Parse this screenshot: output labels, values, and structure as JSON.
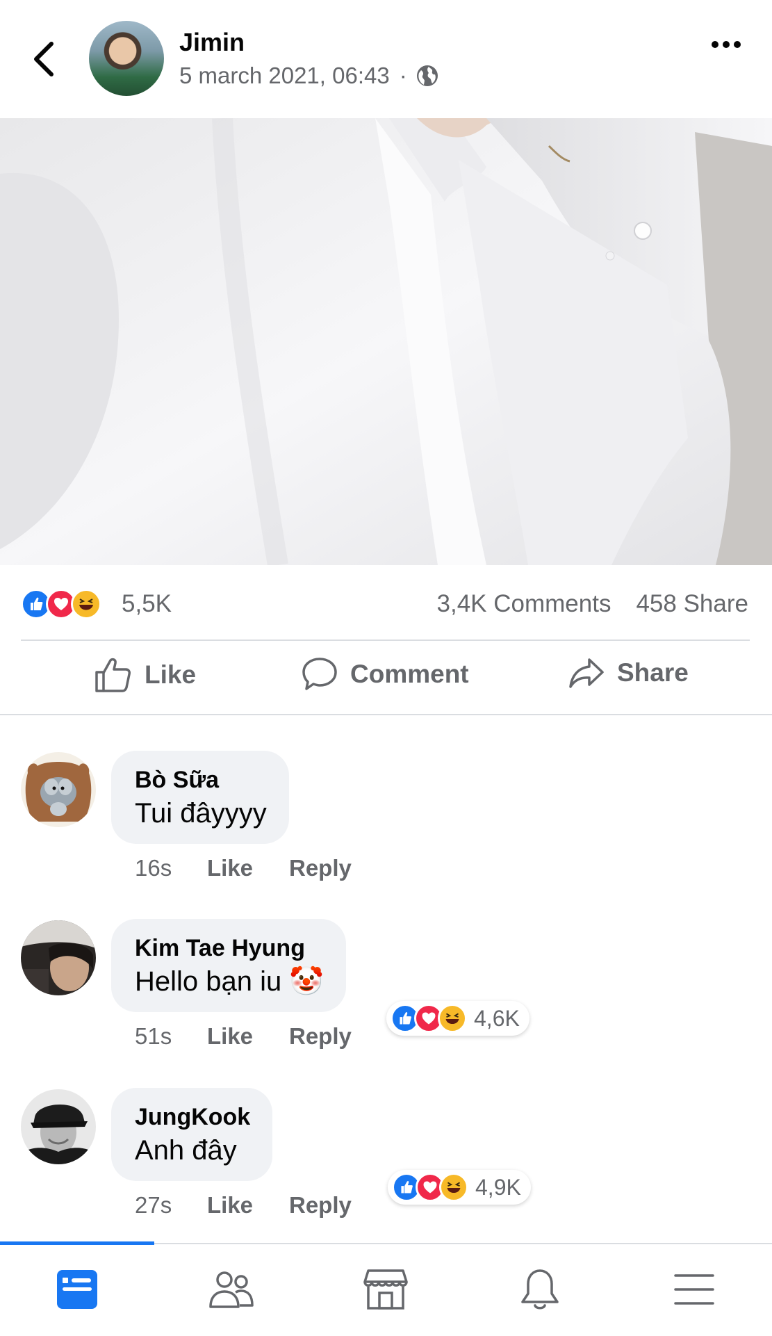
{
  "post": {
    "author": "Jimin",
    "date": "5 march 2021, 06:43",
    "separator": "·",
    "privacy_icon": "globe-icon"
  },
  "stats": {
    "reaction_count": "5,5K",
    "comments": "3,4K Comments",
    "shares": "458 Share"
  },
  "actions": {
    "like": "Like",
    "comment": "Comment",
    "share": "Share"
  },
  "comments": [
    {
      "name": "Bò Sữa",
      "text": "Tui đâyyyy",
      "time": "16s",
      "like": "Like",
      "reply": "Reply"
    },
    {
      "name": "Kim Tae Hyung",
      "text": "Hello bạn iu 🤡",
      "time": "51s",
      "like": "Like",
      "reply": "Reply",
      "reactions": "4,6K"
    },
    {
      "name": "JungKook",
      "text": "Anh đây",
      "time": "27s",
      "like": "Like",
      "reply": "Reply",
      "reactions": "4,9K"
    }
  ],
  "nav": [
    "news-feed-icon",
    "friends-icon",
    "marketplace-icon",
    "notifications-icon",
    "menu-icon"
  ],
  "colors": {
    "accent": "#1877f2",
    "like": "#1877f2",
    "love": "#f0284a",
    "haha": "#f7b928",
    "muted": "#65676b",
    "bubble": "#f0f2f5"
  }
}
